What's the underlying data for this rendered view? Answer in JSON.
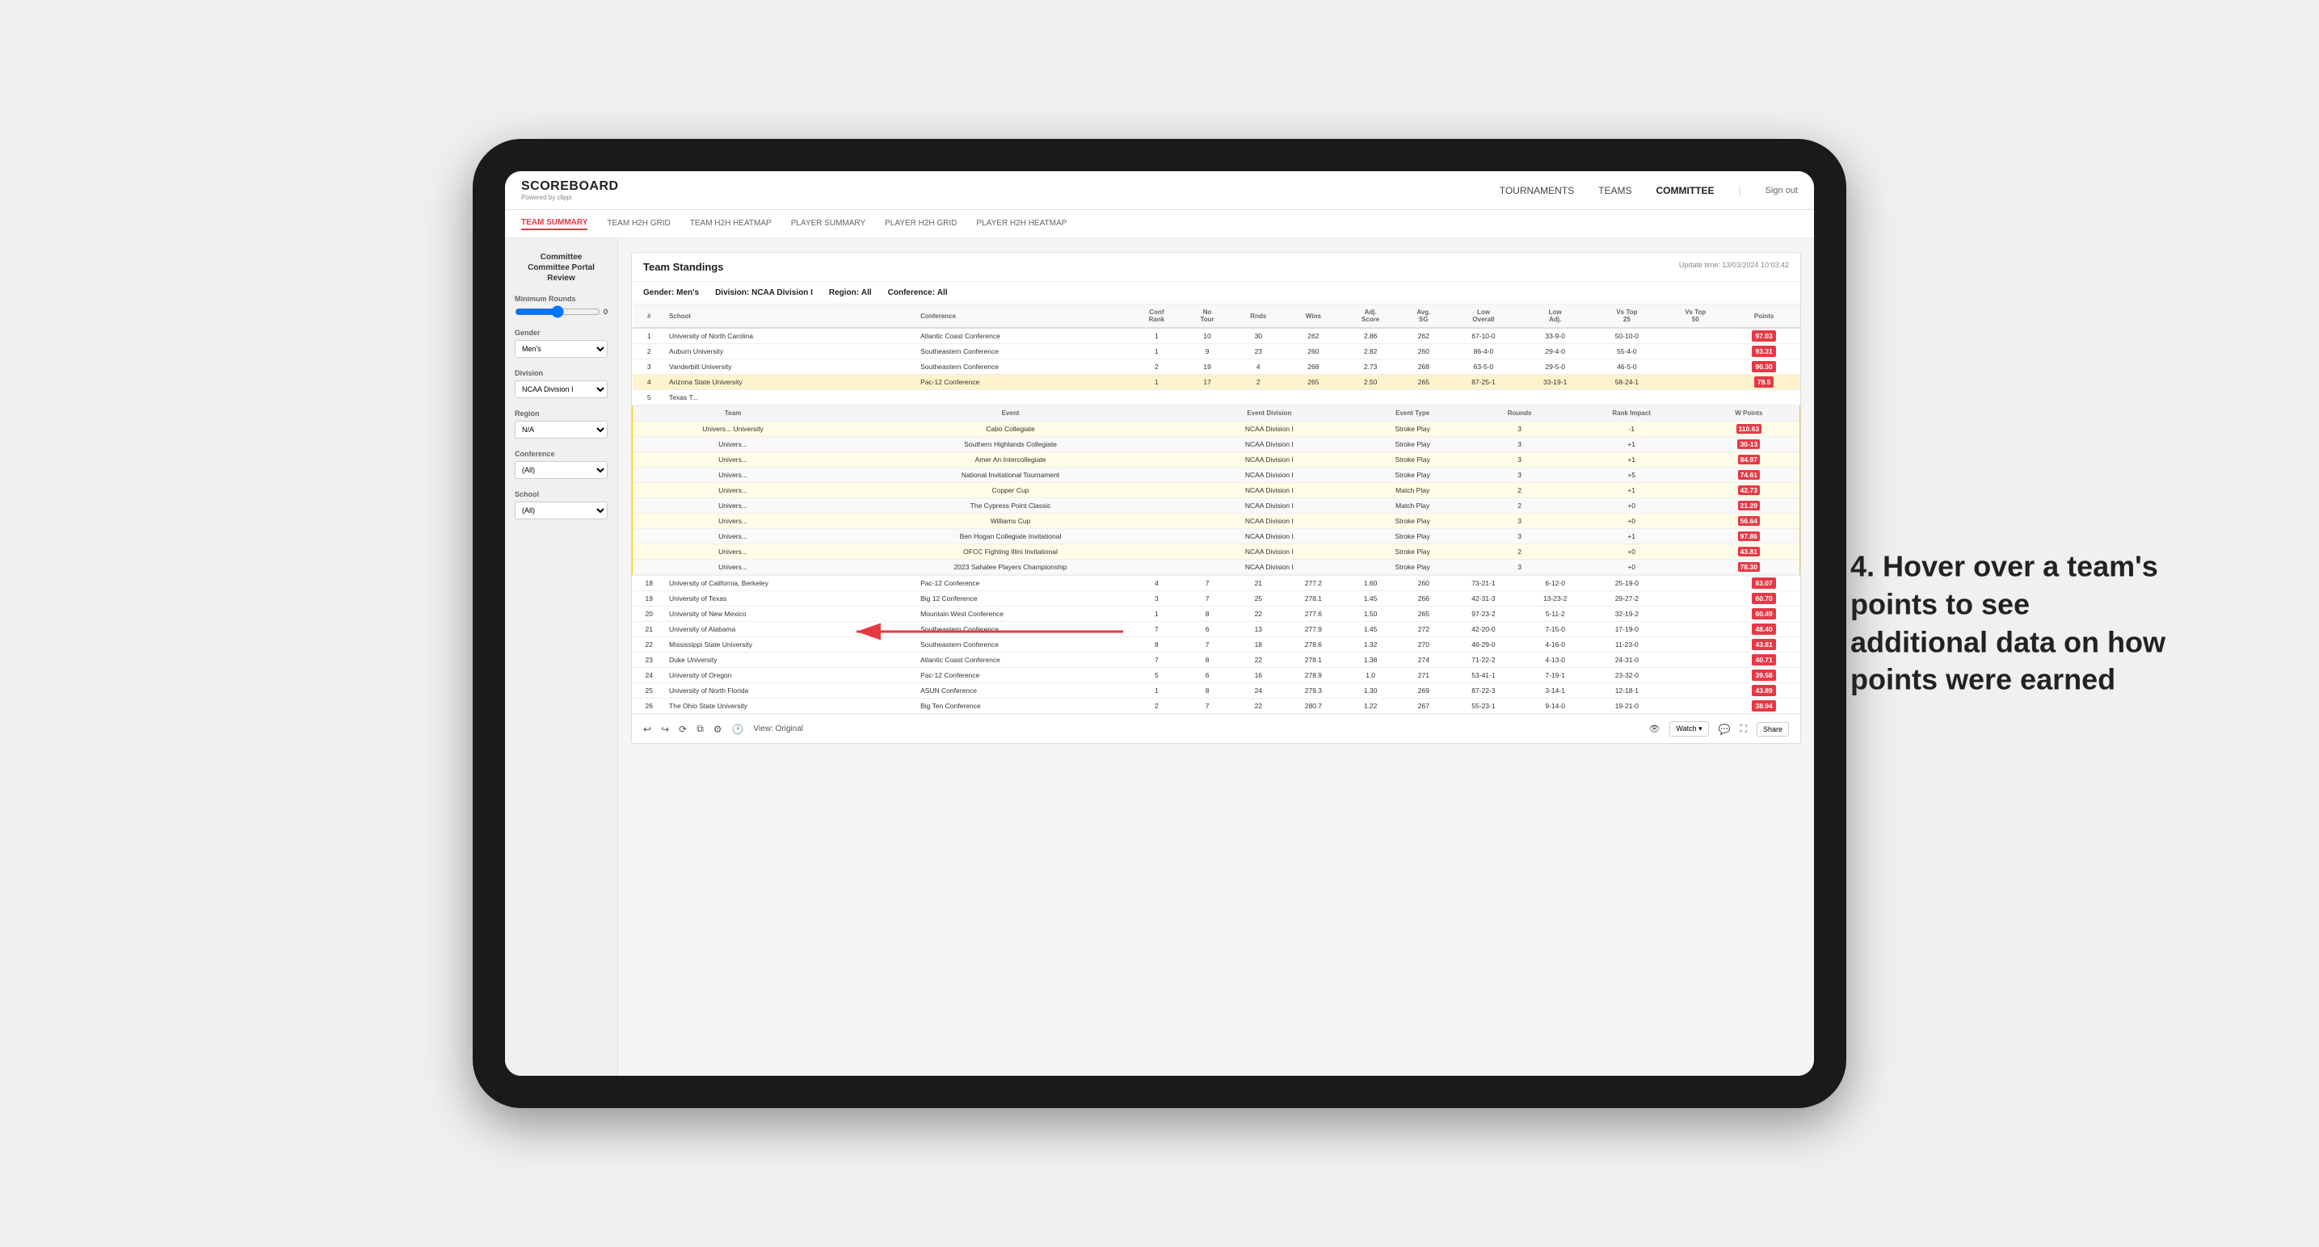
{
  "app": {
    "logo": "SCOREBOARD",
    "logo_sub": "Powered by clippi",
    "nav_links": [
      "TOURNAMENTS",
      "TEAMS",
      "COMMITTEE"
    ],
    "sign_out": "Sign out"
  },
  "sub_nav": {
    "items": [
      "TEAM SUMMARY",
      "TEAM H2H GRID",
      "TEAM H2H HEATMAP",
      "PLAYER SUMMARY",
      "PLAYER H2H GRID",
      "PLAYER H2H HEATMAP"
    ],
    "active": "TEAM SUMMARY"
  },
  "sidebar": {
    "title": "Committee Portal Review",
    "min_rounds_label": "Minimum Rounds",
    "gender_label": "Gender",
    "gender_value": "Men's",
    "division_label": "Division",
    "division_value": "NCAA Division I",
    "region_label": "Region",
    "region_value": "N/A",
    "conference_label": "Conference",
    "conference_value": "(All)",
    "school_label": "School",
    "school_value": "(All)"
  },
  "report": {
    "title": "Team Standings",
    "update_time": "Update time:",
    "update_date": "13/03/2024 10:03:42",
    "filters": {
      "gender_label": "Gender:",
      "gender_value": "Men's",
      "division_label": "Division:",
      "division_value": "NCAA Division I",
      "region_label": "Region:",
      "region_value": "All",
      "conference_label": "Conference:",
      "conference_value": "All"
    },
    "columns": [
      "#",
      "School",
      "Conference",
      "Conf Rank",
      "No Tour",
      "Rnds",
      "Wins",
      "Adj. Score",
      "Avg. SG",
      "Low Overall",
      "Low Adj.",
      "Vs Top 25",
      "Vs Top 50",
      "Points"
    ],
    "teams": [
      {
        "rank": 1,
        "school": "University of North Carolina",
        "conference": "Atlantic Coast Conference",
        "conf_rank": 1,
        "no_tour": 10,
        "rnds": 30,
        "wins": 262,
        "adj_score": 2.86,
        "avg_sg": 262,
        "low_overall": "67-10-0",
        "low_adj": "33-9-0",
        "vs_top25": "50-10-0",
        "vs_top50": "",
        "points": "97.03"
      },
      {
        "rank": 2,
        "school": "Auburn University",
        "conference": "Southeastern Conference",
        "conf_rank": 1,
        "no_tour": 9,
        "rnds": 23,
        "wins": 260,
        "adj_score": 2.82,
        "avg_sg": 260,
        "low_overall": "86-4-0",
        "low_adj": "29-4-0",
        "vs_top25": "55-4-0",
        "vs_top50": "",
        "points": "93.31"
      },
      {
        "rank": 3,
        "school": "Vanderbilt University",
        "conference": "Southeastern Conference",
        "conf_rank": 2,
        "no_tour": 19,
        "rnds": 4,
        "wins": 268,
        "adj_score": 2.73,
        "avg_sg": 268,
        "low_overall": "63-5-0",
        "low_adj": "29-5-0",
        "vs_top25": "46-5-0",
        "vs_top50": "",
        "points": "90.30"
      },
      {
        "rank": 4,
        "school": "Arizona State University",
        "conference": "Pac-12 Conference",
        "conf_rank": 1,
        "no_tour": 17,
        "rnds": 2,
        "wins": 265,
        "adj_score": 2.5,
        "avg_sg": 265,
        "low_overall": "87-25-1",
        "low_adj": "33-19-1",
        "vs_top25": "58-24-1",
        "vs_top50": "",
        "points": "79.5"
      },
      {
        "rank": 5,
        "school": "Texas T...",
        "conference": "",
        "conf_rank": "",
        "no_tour": "",
        "rnds": "",
        "wins": "",
        "adj_score": "",
        "avg_sg": "",
        "low_overall": "",
        "low_adj": "",
        "vs_top25": "",
        "vs_top50": "",
        "points": ""
      },
      {
        "rank": 18,
        "school": "University of California, Berkeley",
        "conference": "Pac-12 Conference",
        "conf_rank": 4,
        "no_tour": 7,
        "rnds": 21,
        "wins": 277.2,
        "adj_score": 1.6,
        "avg_sg": 260,
        "low_overall": "73-21-1",
        "low_adj": "6-12-0",
        "vs_top25": "25-19-0",
        "vs_top50": "",
        "points": "63.07"
      },
      {
        "rank": 19,
        "school": "University of Texas",
        "conference": "Big 12 Conference",
        "conf_rank": 3,
        "no_tour": 7,
        "rnds": 25,
        "wins": 278.1,
        "adj_score": 1.45,
        "avg_sg": 266,
        "low_overall": "42-31-3",
        "low_adj": "13-23-2",
        "vs_top25": "29-27-2",
        "vs_top50": "",
        "points": "60.70"
      },
      {
        "rank": 20,
        "school": "University of New Mexico",
        "conference": "Mountain West Conference",
        "conf_rank": 1,
        "no_tour": 8,
        "rnds": 22,
        "wins": 277.6,
        "adj_score": 1.5,
        "avg_sg": 265,
        "low_overall": "97-23-2",
        "low_adj": "5-11-2",
        "vs_top25": "32-19-2",
        "vs_top50": "",
        "points": "60.49"
      },
      {
        "rank": 21,
        "school": "University of Alabama",
        "conference": "Southeastern Conference",
        "conf_rank": 7,
        "no_tour": 6,
        "rnds": 13,
        "wins": 277.9,
        "adj_score": 1.45,
        "avg_sg": 272,
        "low_overall": "42-20-0",
        "low_adj": "7-15-0",
        "vs_top25": "17-19-0",
        "vs_top50": "",
        "points": "48.40"
      },
      {
        "rank": 22,
        "school": "Mississippi State University",
        "conference": "Southeastern Conference",
        "conf_rank": 8,
        "no_tour": 7,
        "rnds": 18,
        "wins": 278.6,
        "adj_score": 1.32,
        "avg_sg": 270,
        "low_overall": "46-29-0",
        "low_adj": "4-16-0",
        "vs_top25": "11-23-0",
        "vs_top50": "",
        "points": "43.81"
      },
      {
        "rank": 23,
        "school": "Duke University",
        "conference": "Atlantic Coast Conference",
        "conf_rank": 7,
        "no_tour": 8,
        "rnds": 22,
        "wins": 278.1,
        "adj_score": 1.38,
        "avg_sg": 274,
        "low_overall": "71-22-2",
        "low_adj": "4-13-0",
        "vs_top25": "24-31-0",
        "vs_top50": "",
        "points": "40.71"
      },
      {
        "rank": 24,
        "school": "University of Oregon",
        "conference": "Pac-12 Conference",
        "conf_rank": 5,
        "no_tour": 6,
        "rnds": 16,
        "wins": 278.9,
        "adj_score": 1,
        "avg_sg": 271,
        "low_overall": "53-41-1",
        "low_adj": "7-19-1",
        "vs_top25": "23-32-0",
        "vs_top50": "",
        "points": "39.58"
      },
      {
        "rank": 25,
        "school": "University of North Florida",
        "conference": "ASUN Conference",
        "conf_rank": 1,
        "no_tour": 8,
        "rnds": 24,
        "wins": 279.3,
        "adj_score": 1.3,
        "avg_sg": 269,
        "low_overall": "87-22-3",
        "low_adj": "3-14-1",
        "vs_top25": "12-18-1",
        "vs_top50": "",
        "points": "43.89"
      },
      {
        "rank": 26,
        "school": "The Ohio State University",
        "conference": "Big Ten Conference",
        "conf_rank": 2,
        "no_tour": 7,
        "rnds": 22,
        "wins": 280.7,
        "adj_score": 1.22,
        "avg_sg": 267,
        "low_overall": "55-23-1",
        "low_adj": "9-14-0",
        "vs_top25": "19-21-0",
        "vs_top50": "",
        "points": "38.94"
      }
    ],
    "expanded_team": {
      "name": "University",
      "event_columns": [
        "Team",
        "Event",
        "Event Division",
        "Event Type",
        "Rounds",
        "Rank Impact",
        "W Points"
      ],
      "events": [
        {
          "team": "Univers...",
          "event": "Cabo Collegiate",
          "division": "NCAA Division I",
          "type": "Stroke Play",
          "rounds": 3,
          "rank_impact": "-1",
          "w_points": "110.63"
        },
        {
          "team": "Univers...",
          "event": "Southern Highlands Collegiate",
          "division": "NCAA Division I",
          "type": "Stroke Play",
          "rounds": 3,
          "rank_impact": "+1",
          "w_points": "30-13"
        },
        {
          "team": "Univers...",
          "event": "Amer An Intercollegiate",
          "division": "NCAA Division I",
          "type": "Stroke Play",
          "rounds": 3,
          "rank_impact": "+1",
          "w_points": "84.97"
        },
        {
          "team": "Univers...",
          "event": "National Invitational Tournament",
          "division": "NCAA Division I",
          "type": "Stroke Play",
          "rounds": 3,
          "rank_impact": "+5",
          "w_points": "74.61"
        },
        {
          "team": "Univers...",
          "event": "Copper Cup",
          "division": "NCAA Division I",
          "type": "Match Play",
          "rounds": 2,
          "rank_impact": "+1",
          "w_points": "42.73"
        },
        {
          "team": "Univers...",
          "event": "The Cypress Point Classic",
          "division": "NCAA Division I",
          "type": "Match Play",
          "rounds": 2,
          "rank_impact": "+0",
          "w_points": "21.29"
        },
        {
          "team": "Univers...",
          "event": "Williams Cup",
          "division": "NCAA Division I",
          "type": "Stroke Play",
          "rounds": 3,
          "rank_impact": "+0",
          "w_points": "56.64"
        },
        {
          "team": "Univers...",
          "event": "Ben Hogan Collegiate Invitational",
          "division": "NCAA Division I",
          "type": "Stroke Play",
          "rounds": 3,
          "rank_impact": "+1",
          "w_points": "97.86"
        },
        {
          "team": "Univers...",
          "event": "OFCC Fighting Illini Invitational",
          "division": "NCAA Division I",
          "type": "Stroke Play",
          "rounds": 2,
          "rank_impact": "+0",
          "w_points": "43.81"
        },
        {
          "team": "Univers...",
          "event": "2023 Sahalee Players Championship",
          "division": "NCAA Division I",
          "type": "Stroke Play",
          "rounds": 3,
          "rank_impact": "+0",
          "w_points": "78.30"
        }
      ]
    }
  },
  "toolbar": {
    "undo": "↩",
    "redo": "↪",
    "view_label": "View: Original",
    "watch_label": "Watch ▾",
    "share_label": "Share"
  },
  "annotation": {
    "text": "4. Hover over a team's points to see additional data on how points were earned",
    "color": "#222222"
  }
}
